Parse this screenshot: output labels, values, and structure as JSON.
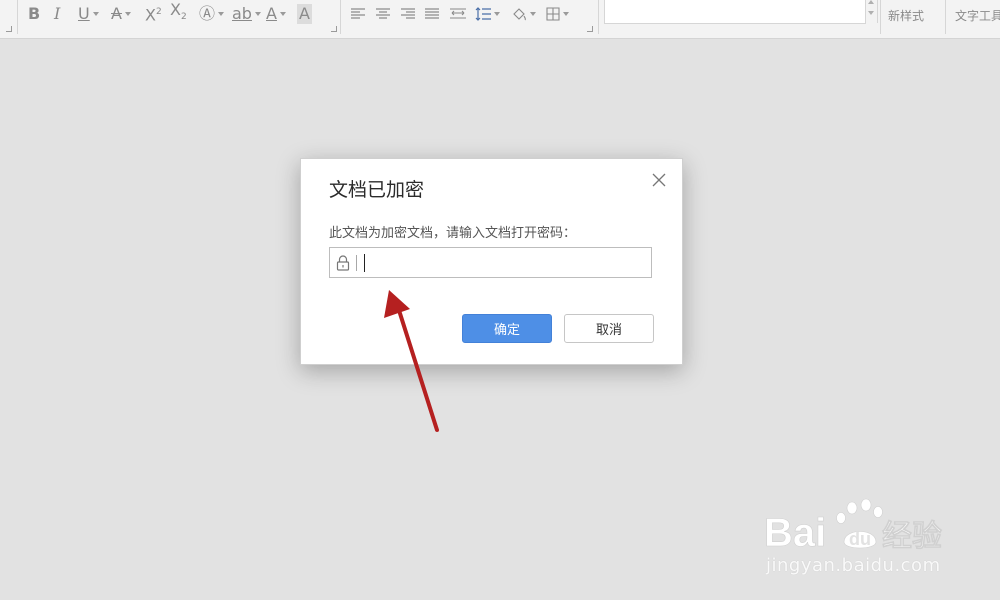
{
  "toolbar": {
    "font_group": {
      "buttons": [
        "bold",
        "italic",
        "underline",
        "strikethrough",
        "superscript",
        "subscript",
        "text-effect",
        "highlight",
        "font-color",
        "char-shading"
      ]
    },
    "paragraph_group": {
      "buttons": [
        "align-left",
        "align-center",
        "align-right",
        "justify",
        "distributed",
        "line-spacing",
        "shading",
        "borders"
      ]
    },
    "styles": {
      "new_style_label": "新样式",
      "text_tools_label": "文字工具"
    }
  },
  "dialog": {
    "title": "文档已加密",
    "prompt": "此文档为加密文档，请输入文档打开密码：",
    "password_value": "",
    "ok_label": "确定",
    "cancel_label": "取消"
  },
  "watermark": {
    "logo_text": "Bai  du 经验",
    "url": "jingyan.baidu.com"
  },
  "colors": {
    "primary_button": "#4e8fe6",
    "arrow": "#b52020",
    "background": "#e2e2e2"
  }
}
